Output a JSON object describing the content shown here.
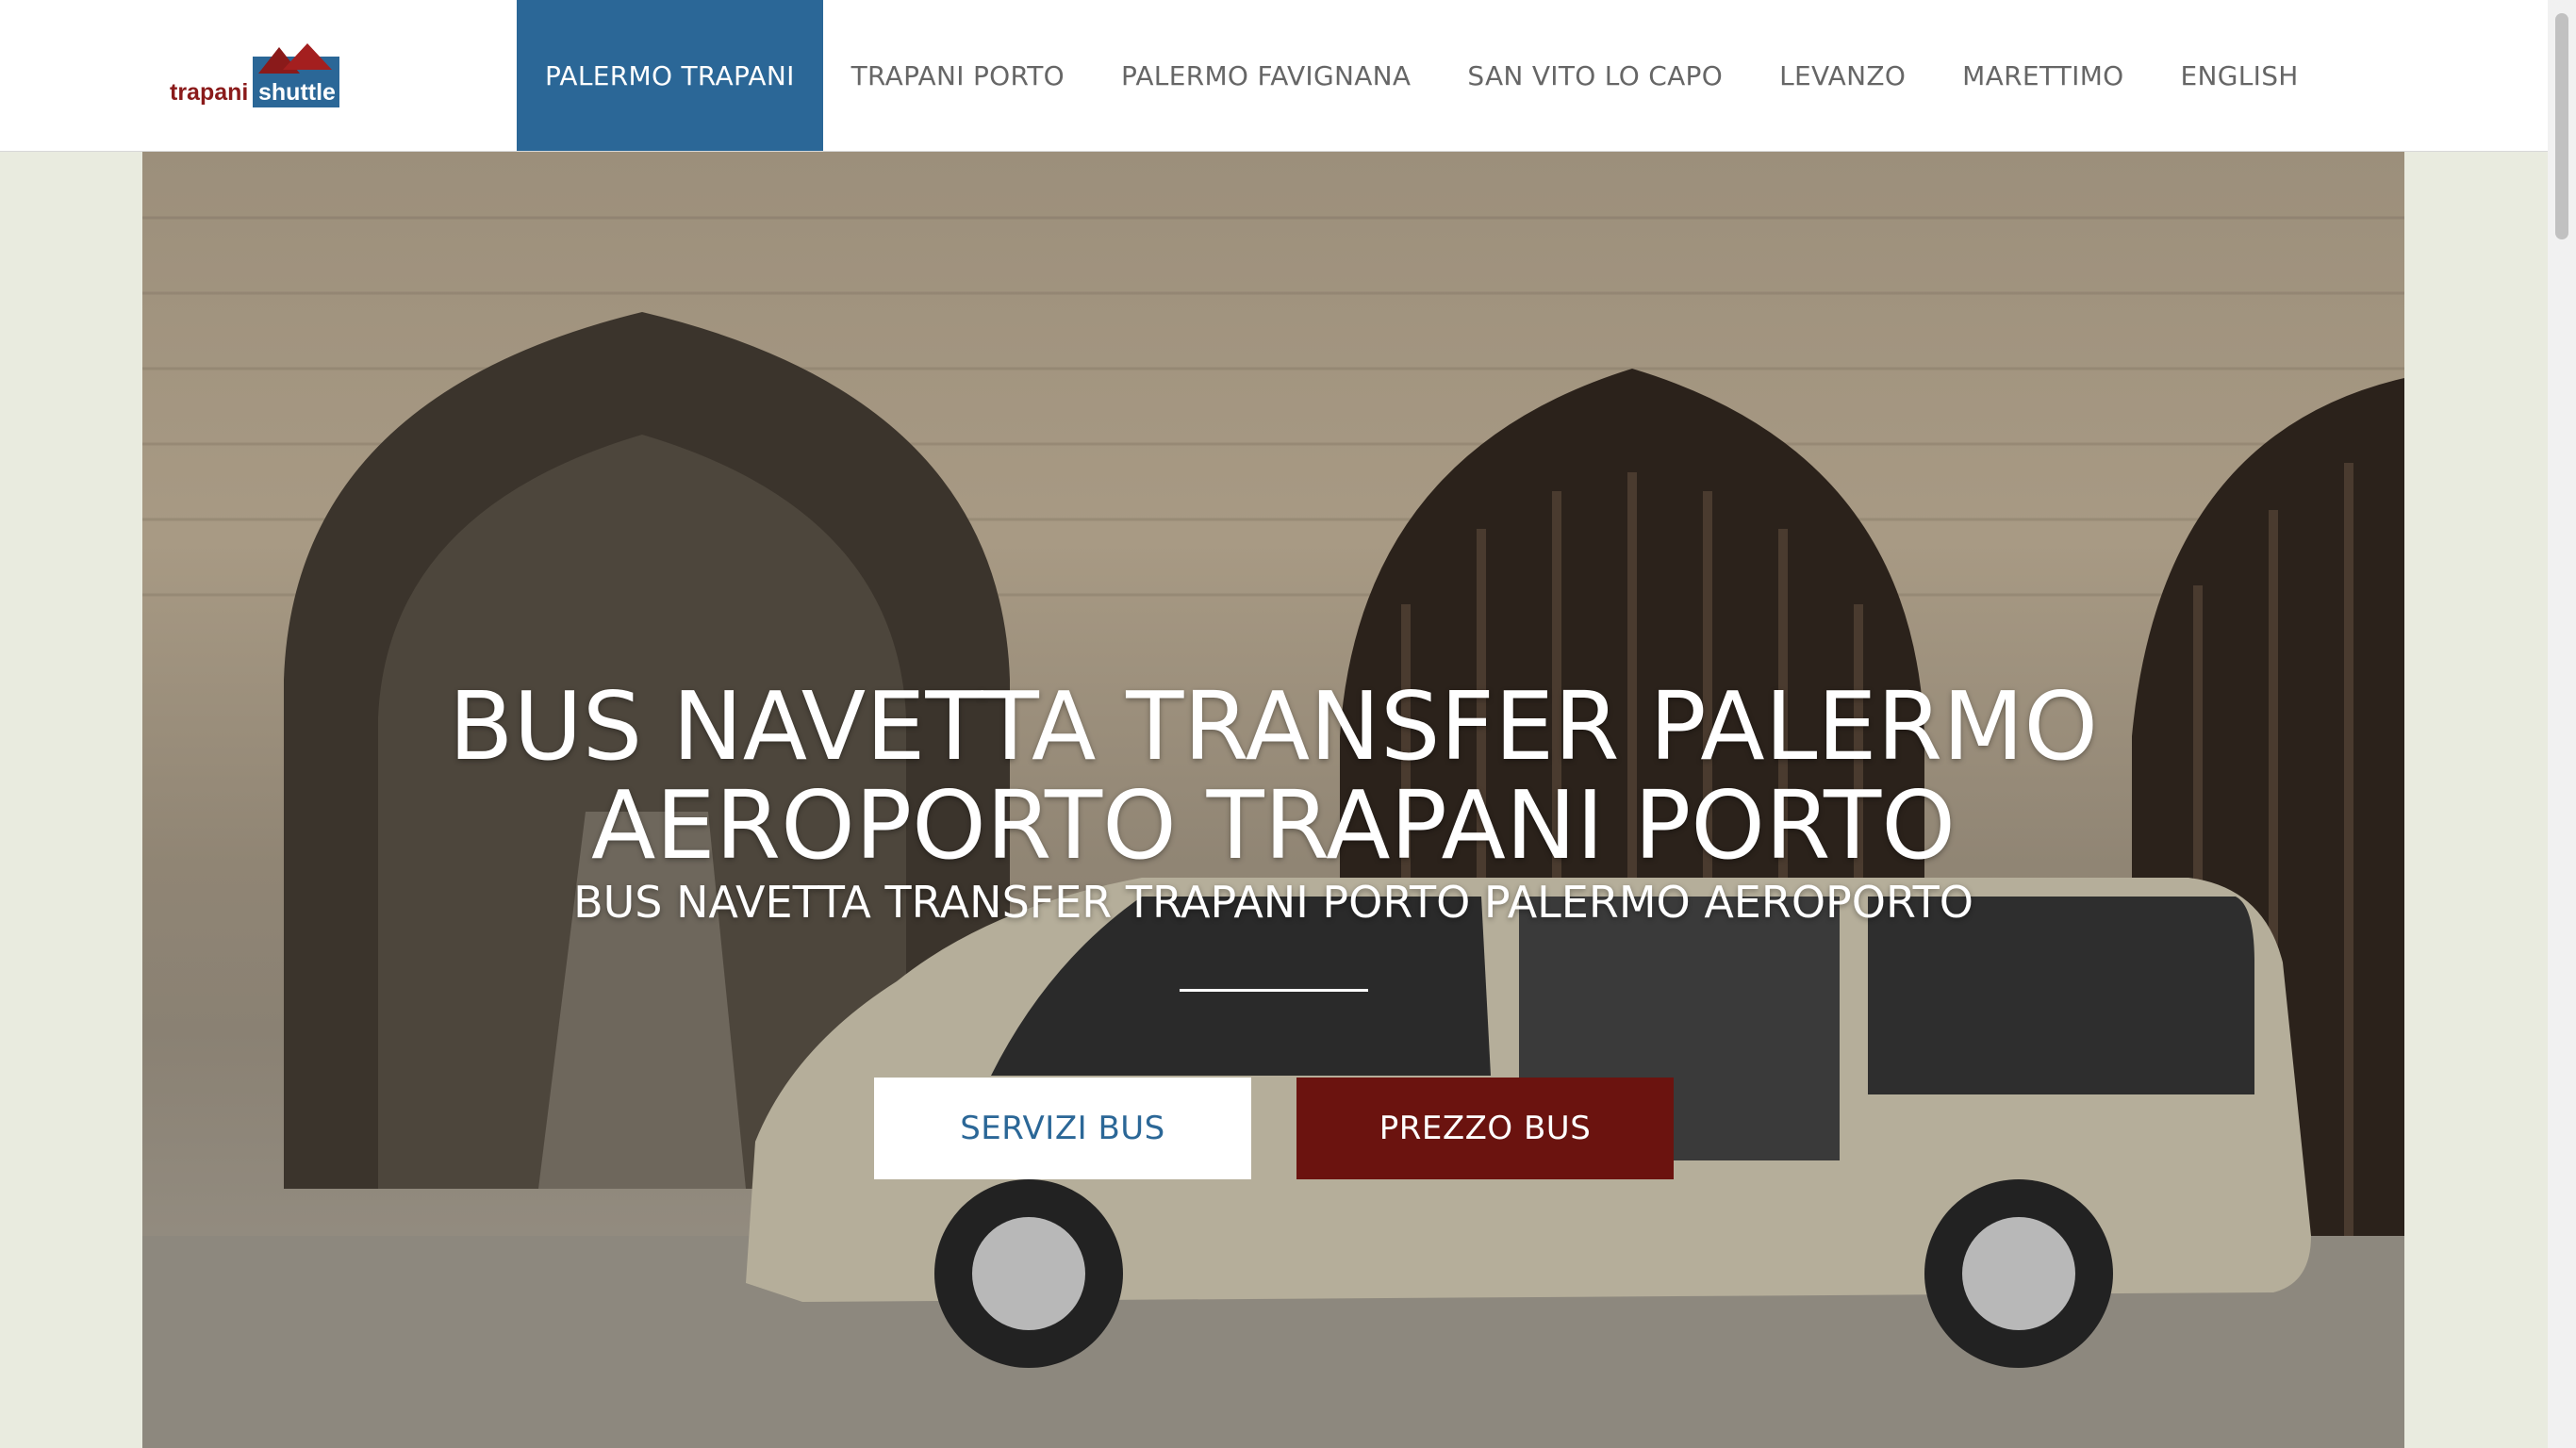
{
  "logo": {
    "word1": "trapani",
    "word2": "shuttle"
  },
  "nav": {
    "items": [
      {
        "label": "PALERMO TRAPANI",
        "active": true
      },
      {
        "label": "TRAPANI PORTO",
        "active": false
      },
      {
        "label": "PALERMO FAVIGNANA",
        "active": false
      },
      {
        "label": "SAN VITO LO CAPO",
        "active": false
      },
      {
        "label": "LEVANZO",
        "active": false
      },
      {
        "label": "MARETTIMO",
        "active": false
      },
      {
        "label": "ENGLISH",
        "active": false
      }
    ]
  },
  "hero": {
    "title_line1": "BUS NAVETTA TRANSFER PALERMO",
    "title_line2": "AEROPORTO TRAPANI PORTO",
    "subtitle": "BUS NAVETTA TRANSFER TRAPANI PORTO PALERMO AEROPORTO",
    "buttons": {
      "servizi": "SERVIZI BUS",
      "prezzo": "PREZZO BUS"
    }
  },
  "colors": {
    "nav_active": "#2b6797",
    "button_primary": "#ffffff",
    "button_secondary": "#6b130f",
    "page_background": "#e9ebdf"
  },
  "icons": [
    "trapani-shuttle-logo",
    "scrollbar"
  ]
}
